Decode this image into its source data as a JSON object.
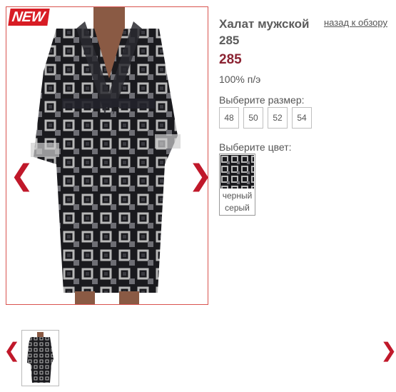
{
  "badge": {
    "label": "NEW",
    "color": "#d81c24"
  },
  "product": {
    "title": "Халат мужской 285",
    "price": "285",
    "material": "100% п/э"
  },
  "nav": {
    "back_link": "назад к обзору",
    "prev_icon": "chevron-left-icon",
    "next_icon": "chevron-right-icon",
    "prev_glyph": "❮",
    "next_glyph": "❯"
  },
  "size_picker": {
    "label": "Выберите размер:",
    "sizes": [
      "48",
      "50",
      "52",
      "54"
    ]
  },
  "color_picker": {
    "label": "Выберите цвет:",
    "colors": [
      {
        "name_line1": "черный",
        "name_line2": "серый"
      }
    ]
  },
  "colors": {
    "accent": "#c0182a",
    "price": "#8b2332",
    "photo_border": "#d9534f"
  }
}
